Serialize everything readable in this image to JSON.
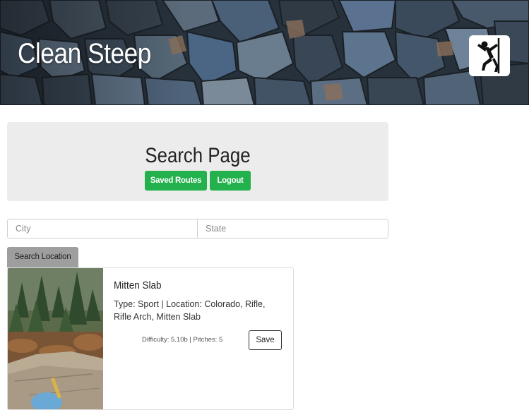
{
  "header": {
    "brand": "Clean Steep",
    "logo_icon": "climber-icon"
  },
  "search_panel": {
    "title": "Search Page",
    "saved_routes_label": "Saved Routes",
    "logout_label": "Logout"
  },
  "search": {
    "city_placeholder": "City",
    "city_value": "",
    "state_placeholder": "State",
    "state_value": "",
    "button_label": "Search Location"
  },
  "results": [
    {
      "name": "Mitten Slab",
      "description": "Type: Sport | Location: Colorado, Rifle, Rifle Arch, Mitten Slab",
      "meta": "Difficulty: 5.10b | Pitches: 5",
      "save_label": "Save"
    }
  ],
  "colors": {
    "accent_green": "#22b14c",
    "panel_gray": "#ececec",
    "search_button_gray": "#9e9e9e"
  }
}
